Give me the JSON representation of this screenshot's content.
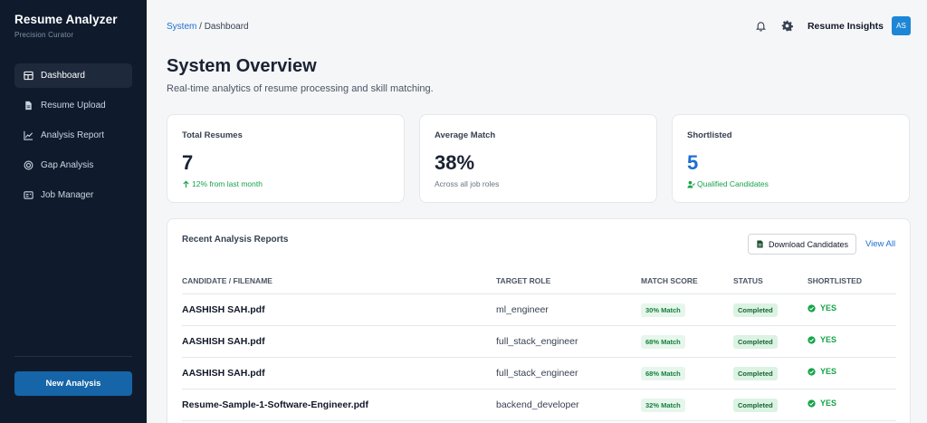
{
  "brand": {
    "title": "Resume Analyzer",
    "subtitle": "Precision Curator"
  },
  "sidebar": {
    "items": [
      {
        "label": "Dashboard",
        "icon": "dashboard-icon",
        "active": true
      },
      {
        "label": "Resume Upload",
        "icon": "file-icon"
      },
      {
        "label": "Analysis Report",
        "icon": "chart-line-icon"
      },
      {
        "label": "Gap Analysis",
        "icon": "target-icon"
      },
      {
        "label": "Job Manager",
        "icon": "id-card-icon"
      }
    ],
    "new_button": "New Analysis"
  },
  "header": {
    "breadcrumb_root": "System",
    "breadcrumb_sep": "/",
    "breadcrumb_current": "Dashboard",
    "user_label": "Resume Insights",
    "avatar_initials": "AS"
  },
  "main": {
    "title": "System Overview",
    "subtitle": "Real-time analytics of resume processing and skill matching."
  },
  "stats": [
    {
      "label": "Total Resumes",
      "value": "7",
      "note": "12% from last month"
    },
    {
      "label": "Average Match",
      "value": "38%",
      "note": "Across all job roles"
    },
    {
      "label": "Shortlisted",
      "value": "5",
      "note": "Qualified Candidates"
    }
  ],
  "reports": {
    "title": "Recent Analysis Reports",
    "download_label": "Download Candidates",
    "view_all": "View All",
    "columns": [
      "CANDIDATE / FILENAME",
      "TARGET ROLE",
      "MATCH SCORE",
      "STATUS",
      "SHORTLISTED"
    ],
    "rows": [
      {
        "name": "AASHISH SAH.pdf",
        "role": "ml_engineer",
        "match": "30% Match",
        "status": "Completed",
        "shortlisted": "YES"
      },
      {
        "name": "AASHISH SAH.pdf",
        "role": "full_stack_engineer",
        "match": "68% Match",
        "status": "Completed",
        "shortlisted": "YES"
      },
      {
        "name": "AASHISH SAH.pdf",
        "role": "full_stack_engineer",
        "match": "68% Match",
        "status": "Completed",
        "shortlisted": "YES"
      },
      {
        "name": "Resume-Sample-1-Software-Engineer.pdf",
        "role": "backend_developer",
        "match": "32% Match",
        "status": "Completed",
        "shortlisted": "YES"
      }
    ]
  },
  "colors": {
    "sidebar_bg": "#0f1b2d",
    "accent": "#1d6fd1",
    "button": "#1565a8",
    "success": "#16a34a"
  }
}
